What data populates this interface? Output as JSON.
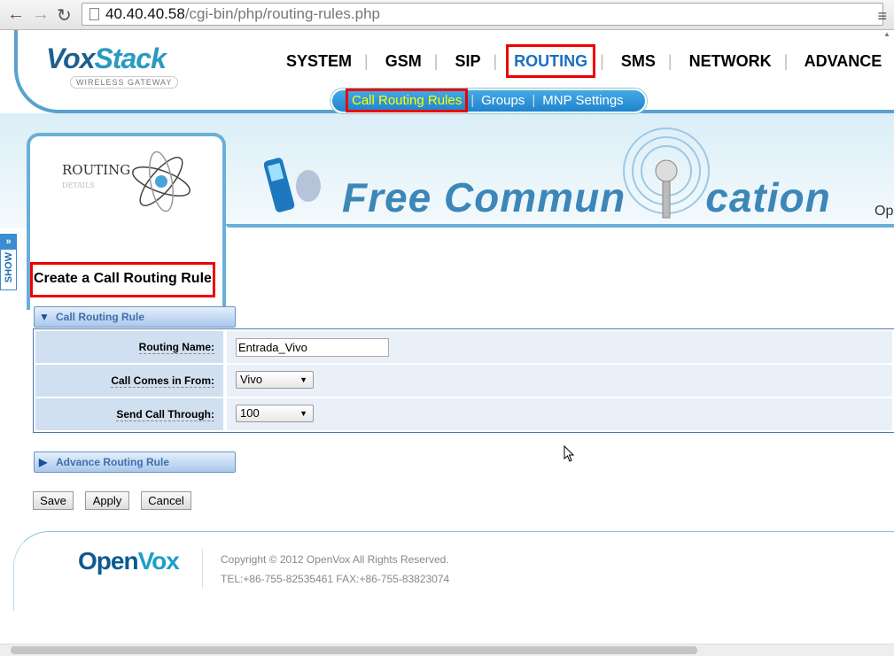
{
  "browser": {
    "url_host": "40.40.40.58",
    "url_path": "/cgi-bin/php/routing-rules.php"
  },
  "brand": {
    "name_a": "Vox",
    "name_b": "Stack",
    "tagline": "WIRELESS GATEWAY"
  },
  "nav": {
    "items": [
      {
        "label": "SYSTEM"
      },
      {
        "label": "GSM"
      },
      {
        "label": "SIP"
      },
      {
        "label": "ROUTING",
        "active": true
      },
      {
        "label": "SMS"
      },
      {
        "label": "NETWORK"
      },
      {
        "label": "ADVANCE"
      }
    ]
  },
  "subnav": {
    "items": [
      {
        "label": "Call Routing Rules",
        "active": true
      },
      {
        "label": "Groups"
      },
      {
        "label": "MNP Settings"
      }
    ]
  },
  "banner": {
    "section_title": "ROUTING",
    "section_sub": "DETAILS",
    "slogan_a": "Free Commun",
    "slogan_b": "cation",
    "right_text": "Op"
  },
  "side_toggle": {
    "label": "SHOW"
  },
  "page": {
    "title": "Create a Call Routing Rule"
  },
  "section1": {
    "title": "Call Routing Rule"
  },
  "form": {
    "routing_name": {
      "label": "Routing Name:",
      "value": "Entrada_Vivo"
    },
    "comes_from": {
      "label": "Call Comes in From:",
      "value": "Vivo"
    },
    "send_through": {
      "label": "Send Call Through:",
      "value": "100"
    }
  },
  "section2": {
    "title": "Advance Routing Rule"
  },
  "buttons": {
    "save": "Save",
    "apply": "Apply",
    "cancel": "Cancel"
  },
  "footer": {
    "logo_a": "Open",
    "logo_b": "Vox",
    "copyright": "Copyright © 2012 OpenVox All Rights Reserved.",
    "contact": "TEL:+86-755-82535461 FAX:+86-755-83823074"
  },
  "colors": {
    "accent": "#1a6fc0",
    "highlight": "#e00000",
    "subnav_active": "#ffff00"
  }
}
